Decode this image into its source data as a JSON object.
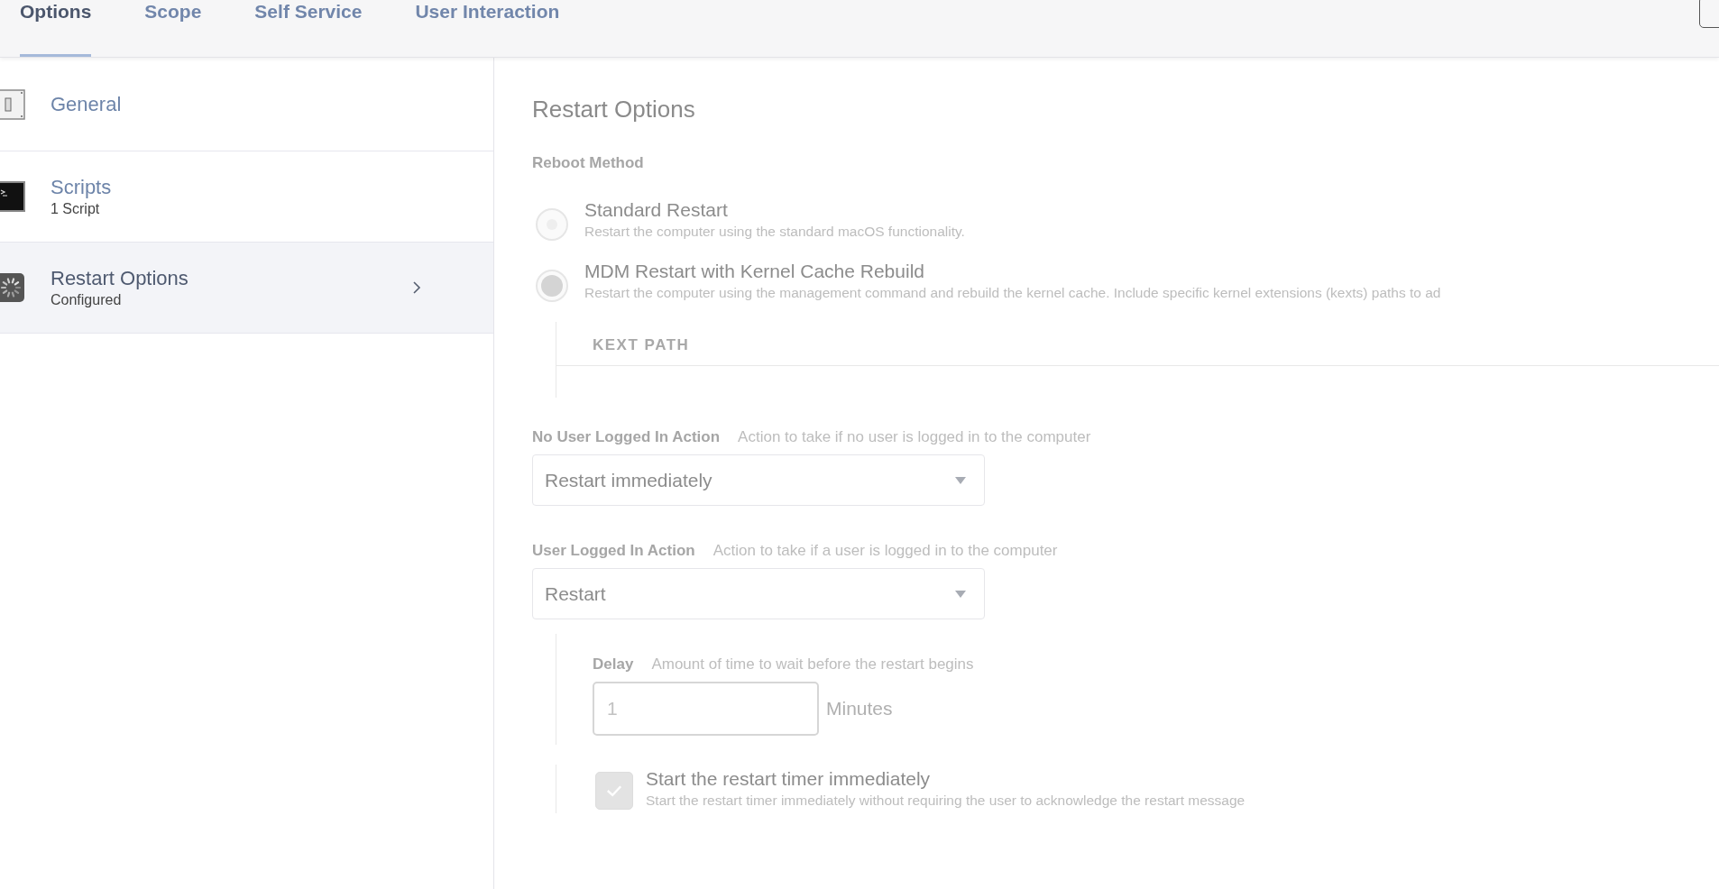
{
  "tabs": [
    {
      "label": "Options",
      "selected": true
    },
    {
      "label": "Scope",
      "selected": false
    },
    {
      "label": "Self Service",
      "selected": false
    },
    {
      "label": "User Interaction",
      "selected": false
    }
  ],
  "sidebar": {
    "items": [
      {
        "kind": "switch",
        "title": "General",
        "selected": false
      },
      {
        "kind": "terminal",
        "title": "Scripts",
        "subtitle": "1 Script",
        "selected": false
      },
      {
        "kind": "spinner",
        "title": "Restart Options",
        "subtitle": "Configured",
        "selected": true
      }
    ]
  },
  "panel": {
    "title": "Restart Options",
    "disabled": true,
    "reboot_method": {
      "label": "Reboot Method",
      "options": [
        {
          "label": "Standard Restart",
          "description": "Restart the computer using the standard macOS functionality.",
          "selected": false
        },
        {
          "label": "MDM Restart with Kernel Cache Rebuild",
          "description": "Restart the computer using the management command and rebuild the kernel cache. Include specific kernel extensions (kexts) paths to ad",
          "selected": true
        }
      ]
    },
    "kext_table": {
      "columns": [
        "KEXT PATH"
      ]
    },
    "no_user_action": {
      "label": "No User Logged In Action",
      "hint": "Action to take if no user is logged in to the computer",
      "value": "Restart immediately"
    },
    "user_action": {
      "label": "User Logged In Action",
      "hint": "Action to take if a user is logged in to the computer",
      "value": "Restart"
    },
    "delay": {
      "label": "Delay",
      "hint": "Amount of time to wait before the restart begins",
      "value": "1",
      "unit": "Minutes"
    },
    "timer": {
      "label": "Start the restart timer immediately",
      "description": "Start the restart timer immediately without requiring the user to acknowledge the restart message",
      "checked": true
    }
  }
}
